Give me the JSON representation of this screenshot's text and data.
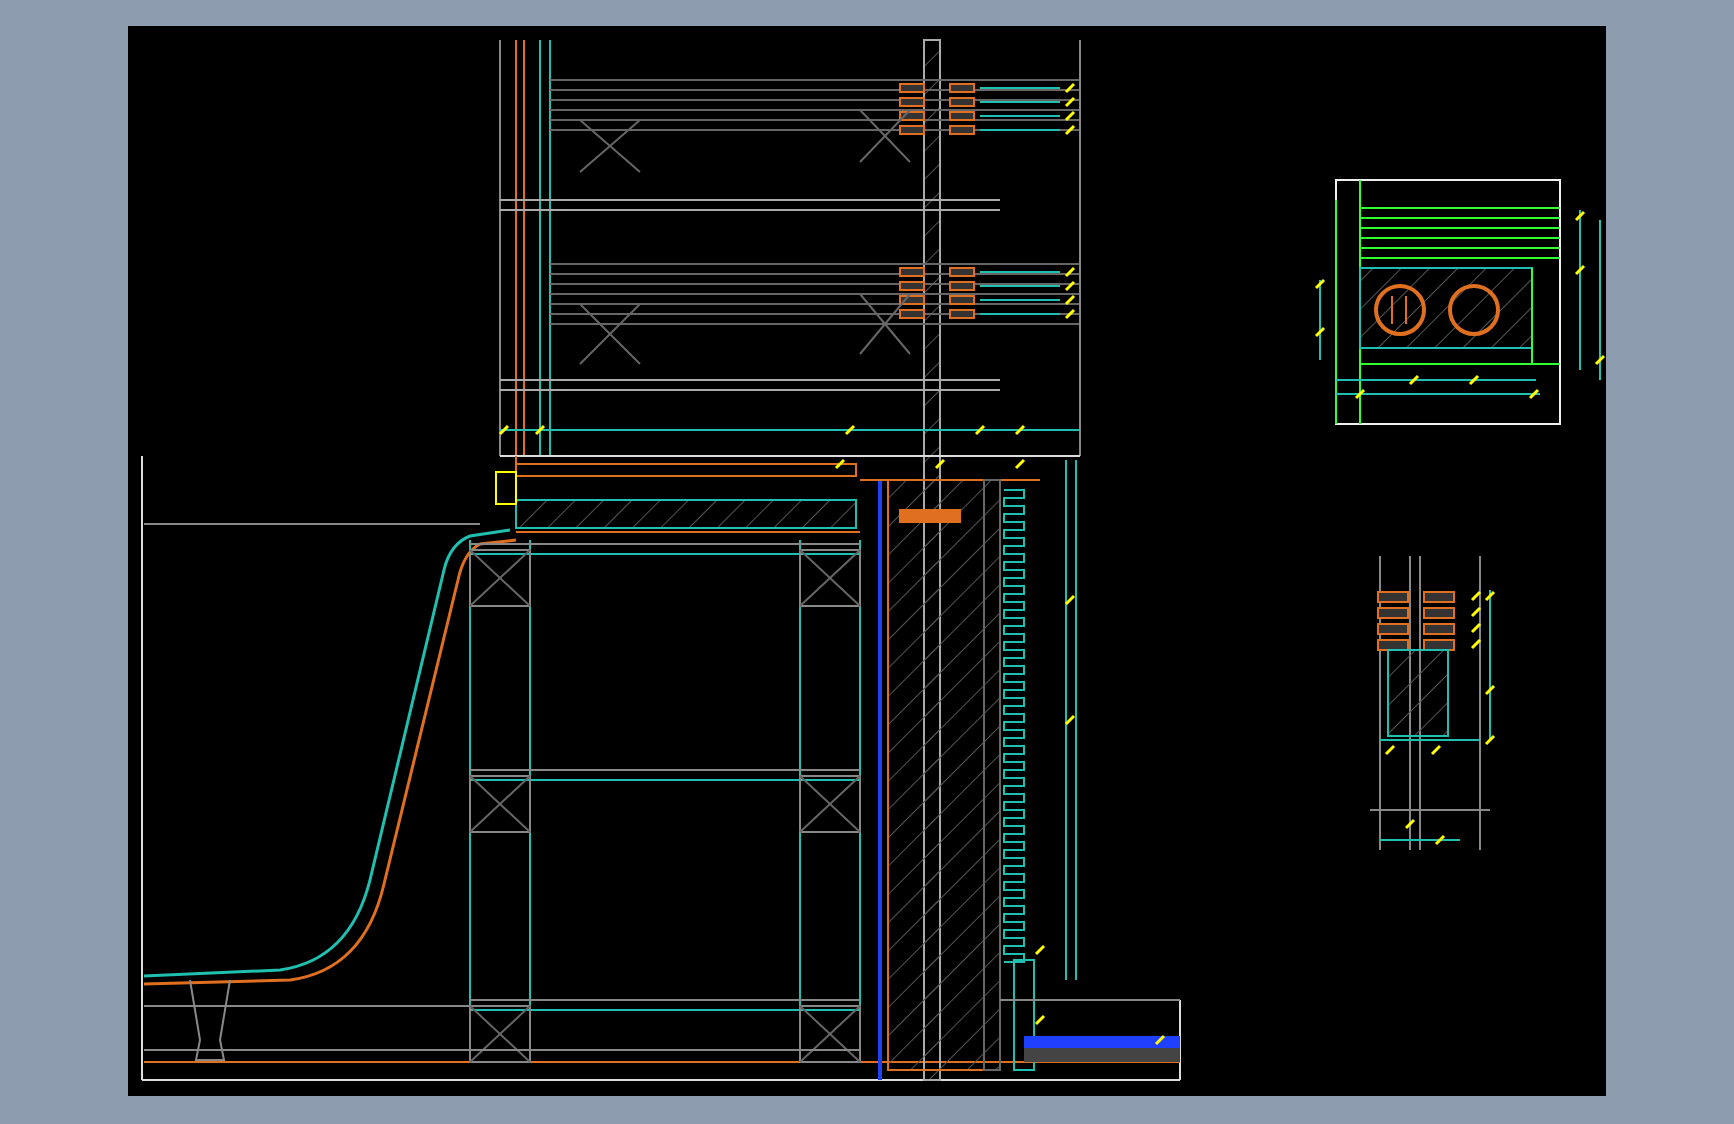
{
  "views": [
    {
      "kind": "section"
    },
    {
      "kind": "plan-detail"
    },
    {
      "kind": "section-detail"
    }
  ]
}
